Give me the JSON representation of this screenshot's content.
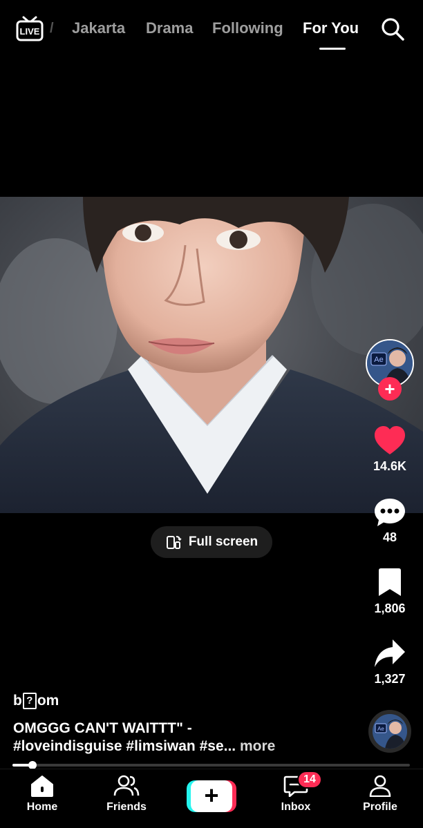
{
  "top_nav": {
    "live_label": "LIVE",
    "tabs": [
      {
        "label": "Jakarta",
        "active": false
      },
      {
        "label": "Drama",
        "active": false
      },
      {
        "label": "Following",
        "active": false
      },
      {
        "label": "For You",
        "active": true
      }
    ],
    "search_icon": "search-icon"
  },
  "video": {
    "fullscreen_label": "Full screen",
    "fullscreen_icon": "rotate-phone-icon"
  },
  "creator": {
    "avatar_text": "Ae",
    "follow_icon": "plus-icon"
  },
  "actions": {
    "likes": "14.6K",
    "comments": "48",
    "saves": "1,806",
    "shares": "1,327",
    "like_color": "#fe2c55"
  },
  "caption": {
    "username_prefix": "b",
    "username_glyph": "?",
    "username_suffix": "om",
    "line1": "OMGGG CAN'T WAITTT\" -",
    "line2": "#loveindisguise #limsiwan #se...",
    "more": "more"
  },
  "music_disc_text": "Ae",
  "progress": {
    "fraction": 0.05
  },
  "bottom_bar": {
    "home": "Home",
    "friends": "Friends",
    "inbox": "Inbox",
    "inbox_badge": "14",
    "profile": "Profile"
  },
  "colors": {
    "accent_red": "#fe2c55",
    "accent_cyan": "#25f4ee",
    "background": "#000000"
  }
}
